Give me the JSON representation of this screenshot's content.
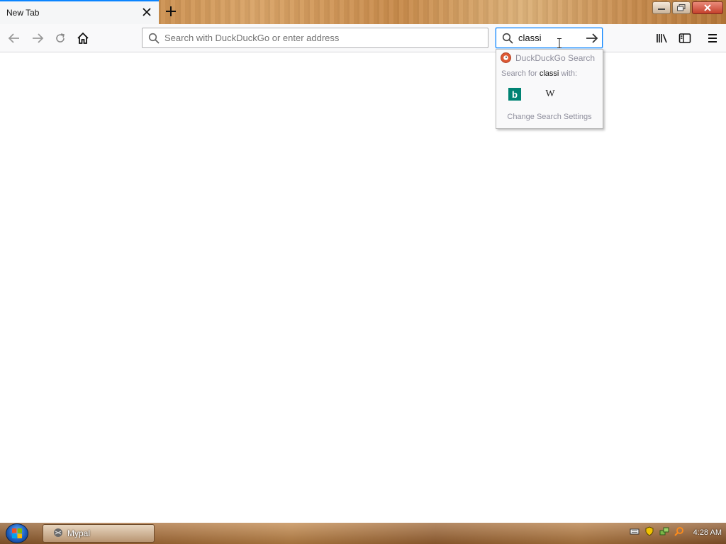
{
  "tab": {
    "title": "New Tab"
  },
  "urlbar": {
    "placeholder": "Search with DuckDuckGo or enter address",
    "value": ""
  },
  "searchbar": {
    "value": "classi"
  },
  "search_popup": {
    "engine_label": "DuckDuckGo Search",
    "search_for_prefix": "Search for ",
    "search_term": "classi",
    "search_for_suffix": " with:",
    "engines": [
      {
        "name": "bing-icon",
        "glyph": "b"
      },
      {
        "name": "wikipedia-icon",
        "glyph": "W"
      }
    ],
    "settings_label": "Change Search Settings"
  },
  "taskbar": {
    "app_label": "Mypal",
    "clock": "4:28 AM"
  },
  "colors": {
    "accent": "#0a84ff",
    "bing": "#008373",
    "ddg": "#de5833"
  }
}
